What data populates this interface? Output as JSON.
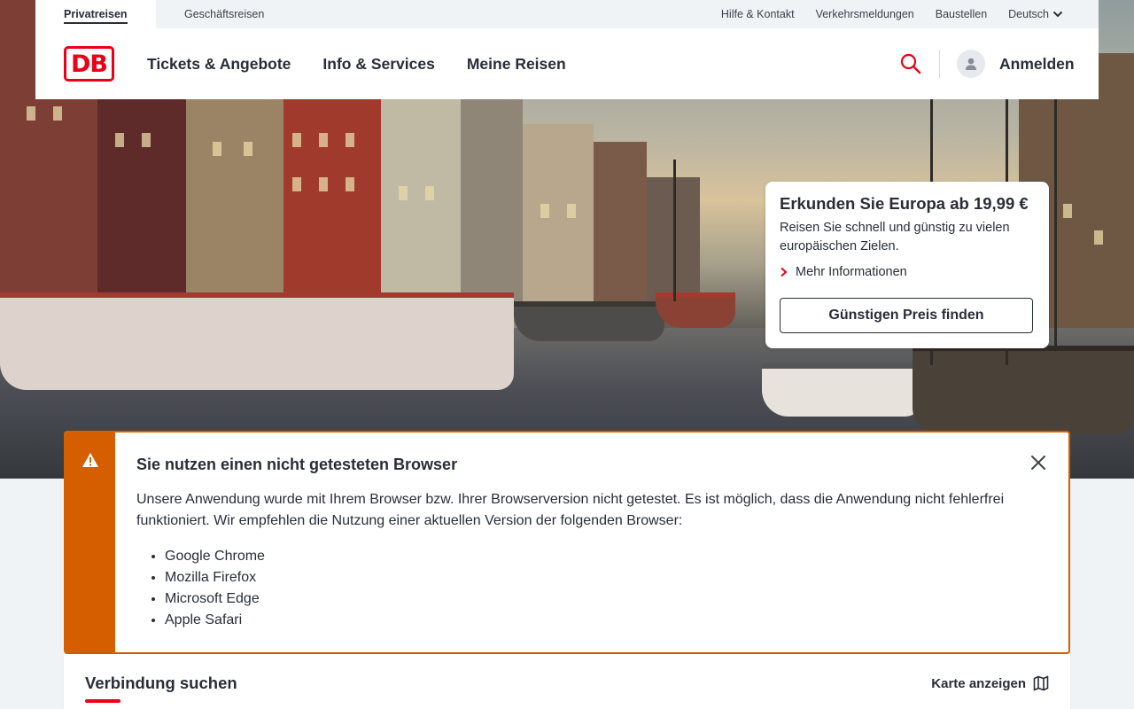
{
  "meta_bar": {
    "tabs": [
      "Privatreisen",
      "Geschäftsreisen"
    ],
    "links": [
      "Hilfe & Kontakt",
      "Verkehrsmeldungen",
      "Baustellen"
    ],
    "language": "Deutsch"
  },
  "logo": {
    "text": "DB"
  },
  "nav": {
    "items": [
      "Tickets & Angebote",
      "Info & Services",
      "Meine Reisen"
    ],
    "login": "Anmelden"
  },
  "promo": {
    "title": "Erkunden Sie Europa ab 19,99 €",
    "text": "Reisen Sie schnell und günstig zu vielen europäischen Zielen.",
    "more": "Mehr Informationen",
    "cta": "Günstigen Preis finden"
  },
  "notice": {
    "title": "Sie nutzen einen nicht getesteten Browser",
    "body": "Unsere Anwendung wurde mit Ihrem Browser bzw. Ihrer Browserversion nicht getestet. Es ist möglich, dass die Anwendung nicht fehlerfrei funktioniert. Wir empfehlen die Nutzung einer aktuellen Version der folgenden Browser:",
    "browsers": [
      "Google Chrome",
      "Mozilla Firefox",
      "Microsoft Edge",
      "Apple Safari"
    ]
  },
  "search_panel": {
    "title": "Verbindung suchen",
    "map_label": "Karte anzeigen"
  },
  "colors": {
    "brand_red": "#ec0016",
    "warning_orange": "#d55f00",
    "text": "#282d37",
    "background": "#f0f3f5"
  }
}
